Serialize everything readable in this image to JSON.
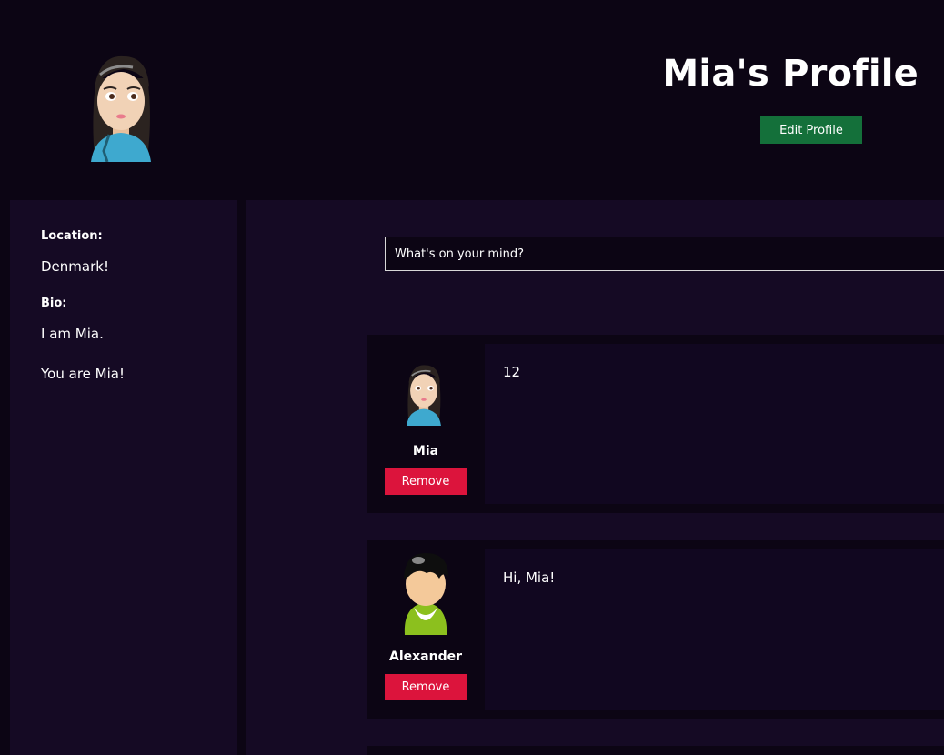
{
  "header": {
    "title": "Mia's Profile",
    "edit_label": "Edit Profile"
  },
  "sidebar": {
    "location_label": "Location:",
    "location_value": "Denmark!",
    "bio_label": "Bio:",
    "bio_lines": [
      "I am Mia.",
      "You are Mia!"
    ]
  },
  "composer": {
    "placeholder": "What's on your mind?"
  },
  "posts": [
    {
      "author": "Mia",
      "avatar": "girl-avatar-icon",
      "text": "12",
      "remove_label": "Remove"
    },
    {
      "author": "Alexander",
      "avatar": "user-avatar-icon",
      "text": "Hi, Mia!",
      "remove_label": "Remove"
    }
  ],
  "colors": {
    "background": "#0c0514",
    "panel": "#150a24",
    "edit_button": "#14703a",
    "remove_button": "#dc143c"
  }
}
